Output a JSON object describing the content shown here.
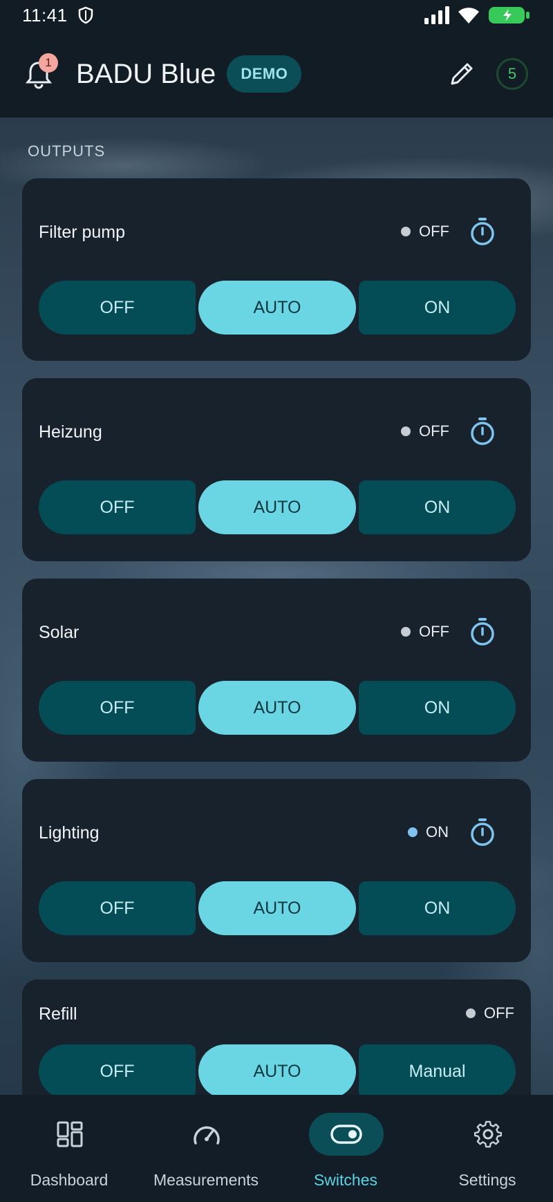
{
  "status_bar": {
    "time": "11:41"
  },
  "header": {
    "notification_count": "1",
    "title": "BADU Blue",
    "demo_label": "DEMO",
    "count_badge": "5"
  },
  "section": {
    "title": "OUTPUTS"
  },
  "outputs": [
    {
      "name": "Filter pump",
      "state": "OFF",
      "state_on": false,
      "has_timer": true,
      "modes": [
        "OFF",
        "AUTO",
        "ON"
      ],
      "selected_mode": "AUTO"
    },
    {
      "name": "Heizung",
      "state": "OFF",
      "state_on": false,
      "has_timer": true,
      "modes": [
        "OFF",
        "AUTO",
        "ON"
      ],
      "selected_mode": "AUTO"
    },
    {
      "name": "Solar",
      "state": "OFF",
      "state_on": false,
      "has_timer": true,
      "modes": [
        "OFF",
        "AUTO",
        "ON"
      ],
      "selected_mode": "AUTO"
    },
    {
      "name": "Lighting",
      "state": "ON",
      "state_on": true,
      "has_timer": true,
      "modes": [
        "OFF",
        "AUTO",
        "ON"
      ],
      "selected_mode": "AUTO"
    },
    {
      "name": "Refill",
      "state": "OFF",
      "state_on": false,
      "has_timer": false,
      "modes": [
        "OFF",
        "AUTO",
        "Manual"
      ],
      "selected_mode": "AUTO"
    }
  ],
  "nav": {
    "items": [
      {
        "label": "Dashboard",
        "icon": "dashboard-icon",
        "active": false
      },
      {
        "label": "Measurements",
        "icon": "gauge-icon",
        "active": false
      },
      {
        "label": "Switches",
        "icon": "toggle-icon",
        "active": true
      },
      {
        "label": "Settings",
        "icon": "gear-icon",
        "active": false
      }
    ]
  },
  "colors": {
    "accent": "#6ad6e3",
    "segment_bg": "#044d57",
    "card_bg": "#18222c",
    "header_bg": "#111c25",
    "on_dot": "#7fc4ef",
    "off_dot": "#c5ccd2",
    "badge_red": "#f4a7a0",
    "count_green": "#4cc36a"
  }
}
